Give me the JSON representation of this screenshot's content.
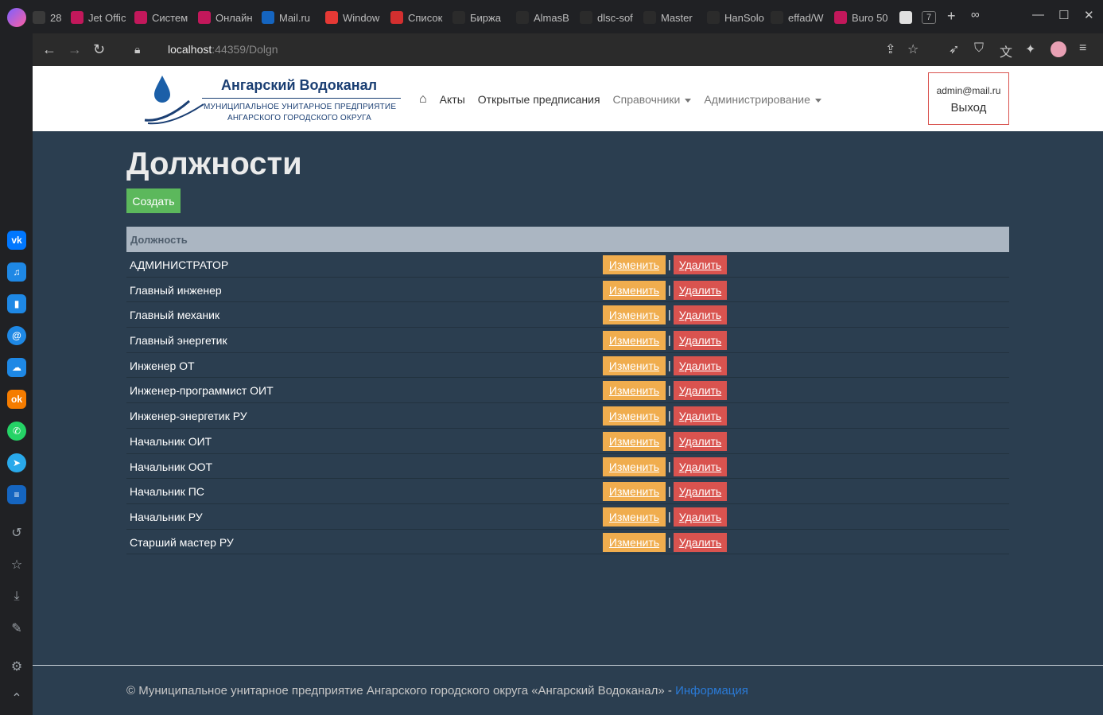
{
  "browser": {
    "tabs": [
      {
        "label": "28",
        "color": "#3a3a3a"
      },
      {
        "label": "Jet Offic",
        "color": "#c2185b"
      },
      {
        "label": "Систем",
        "color": "#c2185b"
      },
      {
        "label": "Онлайн",
        "color": "#c2185b"
      },
      {
        "label": "Mail.ru",
        "color": "#1565c0"
      },
      {
        "label": "Window",
        "color": "#e53935"
      },
      {
        "label": "Список",
        "color": "#d32f2f"
      },
      {
        "label": "Биржа",
        "color": "#2b2b2b"
      },
      {
        "label": "AlmasB",
        "color": "#2b2b2b"
      },
      {
        "label": "dlsc-sof",
        "color": "#2b2b2b"
      },
      {
        "label": "Master",
        "color": "#2b2b2b"
      },
      {
        "label": "HanSolo",
        "color": "#2b2b2b"
      },
      {
        "label": "effad/W",
        "color": "#2b2b2b"
      },
      {
        "label": "Buro 50",
        "color": "#c2185b"
      }
    ],
    "tab_count": "7",
    "url_host": "localhost",
    "url_rest": ":44359/Dolgn"
  },
  "site": {
    "logo_title": "Ангарский Водоканал",
    "logo_sub1": "МУНИЦИПАЛЬНОЕ УНИТАРНОЕ ПРЕДПРИЯТИЕ",
    "logo_sub2": "АНГАРСКОГО ГОРОДСКОГО ОКРУГА",
    "nav": {
      "acts": "Акты",
      "open": "Открытые предписания",
      "refs": "Справочники",
      "admin": "Администрирование"
    },
    "user_email": "admin@mail.ru",
    "logout": "Выход"
  },
  "main": {
    "title": "Должности",
    "create": "Создать",
    "column": "Должность",
    "edit_label": "Изменить",
    "delete_label": "Удалить",
    "rows": [
      "АДМИНИСТРАТОР",
      "Главный инженер",
      "Главный механик",
      "Главный энергетик",
      "Инженер ОТ",
      "Инженер-программист ОИТ",
      "Инженер-энергетик РУ",
      "Начальник ОИТ",
      "Начальник ООТ",
      "Начальник ПС",
      "Начальник РУ",
      "Старший мастер РУ"
    ]
  },
  "footer": {
    "text": "© Муниципальное унитарное предприятие Ангарского городского округа «Ангарский Водоканал» - ",
    "link": "Информация"
  }
}
